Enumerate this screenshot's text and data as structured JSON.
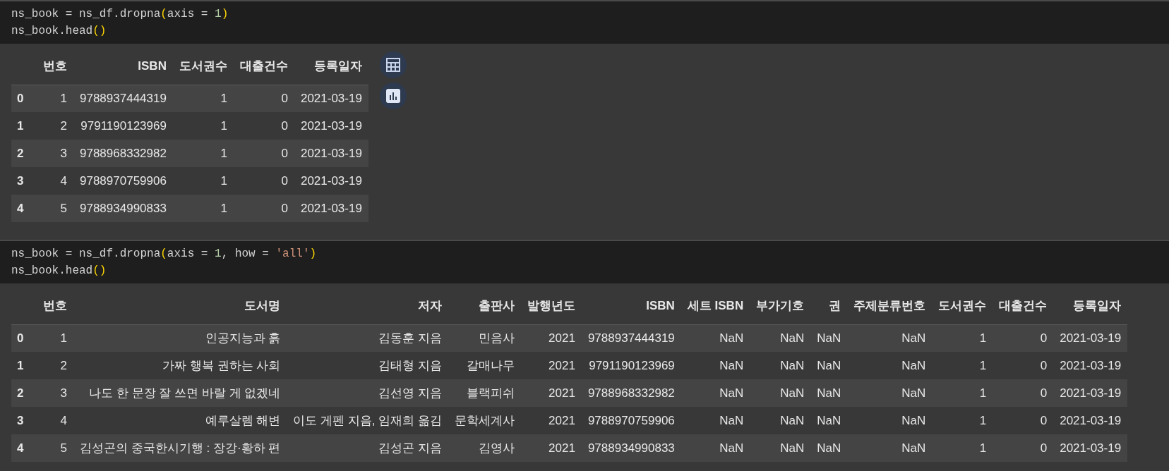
{
  "cells": [
    {
      "code": [
        [
          {
            "text": "ns_book = ns_df.dropna",
            "kind": "plain"
          },
          {
            "text": "(",
            "kind": "paren"
          },
          {
            "text": "axis = ",
            "kind": "plain"
          },
          {
            "text": "1",
            "kind": "number"
          },
          {
            "text": ")",
            "kind": "paren"
          }
        ],
        [
          {
            "text": "ns_book.head",
            "kind": "plain"
          },
          {
            "text": "()",
            "kind": "paren"
          }
        ]
      ],
      "output": {
        "quick_actions": true,
        "table": {
          "columns": [
            "번호",
            "ISBN",
            "도서권수",
            "대출건수",
            "등록일자"
          ],
          "rows": [
            {
              "index": "0",
              "cells": [
                "1",
                "9788937444319",
                "1",
                "0",
                "2021-03-19"
              ]
            },
            {
              "index": "1",
              "cells": [
                "2",
                "9791190123969",
                "1",
                "0",
                "2021-03-19"
              ]
            },
            {
              "index": "2",
              "cells": [
                "3",
                "9788968332982",
                "1",
                "0",
                "2021-03-19"
              ]
            },
            {
              "index": "3",
              "cells": [
                "4",
                "9788970759906",
                "1",
                "0",
                "2021-03-19"
              ]
            },
            {
              "index": "4",
              "cells": [
                "5",
                "9788934990833",
                "1",
                "0",
                "2021-03-19"
              ]
            }
          ]
        }
      }
    },
    {
      "code": [
        [
          {
            "text": "ns_book = ns_df.dropna",
            "kind": "plain"
          },
          {
            "text": "(",
            "kind": "paren"
          },
          {
            "text": "axis = ",
            "kind": "plain"
          },
          {
            "text": "1",
            "kind": "number"
          },
          {
            "text": ", how = ",
            "kind": "plain"
          },
          {
            "text": "'all'",
            "kind": "string"
          },
          {
            "text": ")",
            "kind": "paren"
          }
        ],
        [
          {
            "text": "ns_book.head",
            "kind": "plain"
          },
          {
            "text": "()",
            "kind": "paren"
          }
        ]
      ],
      "output": {
        "table": {
          "columns": [
            "번호",
            "도서명",
            "저자",
            "출판사",
            "발행년도",
            "ISBN",
            "세트 ISBN",
            "부가기호",
            "권",
            "주제분류번호",
            "도서권수",
            "대출건수",
            "등록일자"
          ],
          "rows": [
            {
              "index": "0",
              "cells": [
                "1",
                "인공지능과 흙",
                "김동훈 지음",
                "민음사",
                "2021",
                "9788937444319",
                "NaN",
                "NaN",
                "NaN",
                "NaN",
                "1",
                "0",
                "2021-03-19"
              ]
            },
            {
              "index": "1",
              "cells": [
                "2",
                "가짜 행복 권하는 사회",
                "김태형 지음",
                "갈매나무",
                "2021",
                "9791190123969",
                "NaN",
                "NaN",
                "NaN",
                "NaN",
                "1",
                "0",
                "2021-03-19"
              ]
            },
            {
              "index": "2",
              "cells": [
                "3",
                "나도 한 문장 잘 쓰면 바랄 게 없겠네",
                "김선영 지음",
                "블랙피쉬",
                "2021",
                "9788968332982",
                "NaN",
                "NaN",
                "NaN",
                "NaN",
                "1",
                "0",
                "2021-03-19"
              ]
            },
            {
              "index": "3",
              "cells": [
                "4",
                "예루살렘 해변",
                "이도 게펜 지음, 임재희 옮김",
                "문학세계사",
                "2021",
                "9788970759906",
                "NaN",
                "NaN",
                "NaN",
                "NaN",
                "1",
                "0",
                "2021-03-19"
              ]
            },
            {
              "index": "4",
              "cells": [
                "5",
                "김성곤의 중국한시기행 : 장강·황하 편",
                "김성곤 지음",
                "김영사",
                "2021",
                "9788934990833",
                "NaN",
                "NaN",
                "NaN",
                "NaN",
                "1",
                "0",
                "2021-03-19"
              ]
            }
          ]
        }
      }
    }
  ]
}
